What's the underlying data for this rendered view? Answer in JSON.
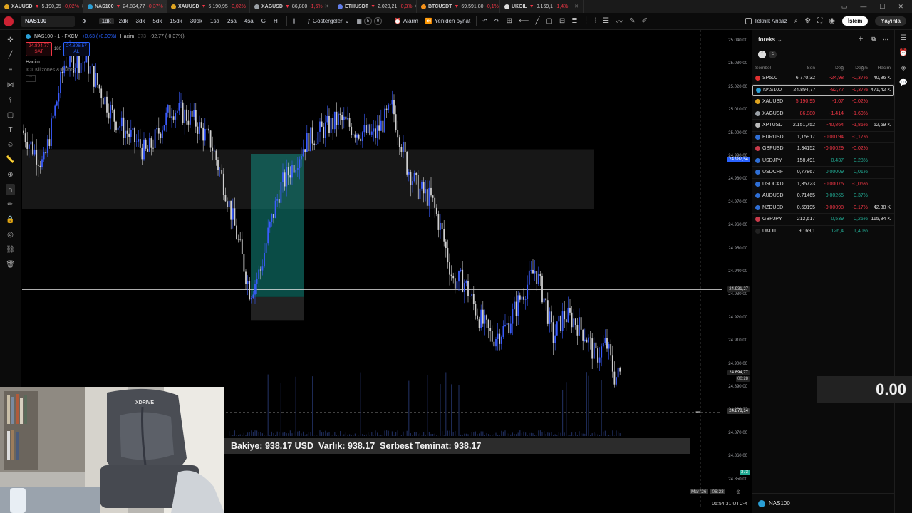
{
  "tabs": [
    {
      "symbol": "XAUUSD",
      "text": "5.190,95",
      "chg": "-0,02%",
      "color": "#e0a520"
    },
    {
      "symbol": "NAS100",
      "text": "24.894,77",
      "chg": "-0,37%",
      "color": "#2a9fd6"
    },
    {
      "symbol": "XAUUSD",
      "text": "5.190,95",
      "chg": "-0,02%",
      "color": "#e0a520"
    },
    {
      "symbol": "XAGUSD",
      "text": "86,880",
      "chg": "-1,6%",
      "color": "#9aa0a6"
    },
    {
      "symbol": "ETHUSDT",
      "text": "2.020,21",
      "chg": "-0,3%",
      "color": "#627eea"
    },
    {
      "symbol": "BTCUSDT",
      "text": "69.591,80",
      "chg": "-0,1%",
      "color": "#f7931a"
    },
    {
      "symbol": "UKOIL",
      "text": "9.169,1",
      "chg": "-1,4%",
      "color": "#ddd"
    }
  ],
  "toolbar": {
    "symbol": "NAS100",
    "timeframes": [
      "1dk",
      "2dk",
      "3dk",
      "5dk",
      "15dk",
      "30dk",
      "1sa",
      "2sa",
      "4sa",
      "G",
      "H"
    ],
    "active_tf": "1dk",
    "indicators": "Göstergeler",
    "count1": "5",
    "count2": "0",
    "alarm": "Alarm",
    "replay": "Yeniden oynat",
    "tech": "Teknik Analiz",
    "trade": "İşlem",
    "publish": "Yayınla"
  },
  "legend": {
    "title": "NAS100 · 1 · FXCM",
    "chg": "+0,63 (+0,00%)",
    "volume_label": "Hacim",
    "volume_val": "373",
    "volume_chg": "-92,77 (-0,37%)",
    "sell_price": "24.894,77",
    "sell_label": "SAT",
    "spread": "180",
    "buy_price": "24.896,57",
    "buy_label": "AL",
    "hacim": "Hacim",
    "indicator": "ICT Killzones & Pivots"
  },
  "price_axis": {
    "ticks": [
      "25.040,00",
      "25.030,00",
      "25.020,00",
      "25.010,00",
      "25.000,00",
      "24.990,00",
      "24.980,00",
      "24.970,00",
      "24.960,00",
      "24.950,00",
      "24.940,00",
      "24.930,00",
      "24.920,00",
      "24.910,00",
      "24.900,00",
      "24.890,00",
      "24.880,00",
      "24.870,00",
      "24.860,00",
      "24.850,00"
    ],
    "label_top": "24.987,54",
    "label_line": "24.931,27",
    "label_last": "24.894,77",
    "label_countdown": "00:28",
    "label_cross": "24.878,14",
    "vol_badge": "373"
  },
  "watchlist": {
    "name": "foreks",
    "headers": [
      "Sembol",
      "Son",
      "Değ",
      "Değ%",
      "Hacim"
    ],
    "rows": [
      {
        "sym": "SP500",
        "last": "6.770,32",
        "chg": "-24,98",
        "pct": "-0,37%",
        "vol": "40,86 K",
        "dir": "neg",
        "color": "#e03030"
      },
      {
        "sym": "NAS100",
        "last": "24.894,77",
        "chg": "-92,77",
        "pct": "-0,37%",
        "vol": "471,42 K",
        "dir": "neg",
        "color": "#2a9fd6"
      },
      {
        "sym": "XAUUSD",
        "last": "5.190,95",
        "chg": "-1,07",
        "pct": "-0,02%",
        "vol": "",
        "dir": "neg",
        "color": "#e0a520"
      },
      {
        "sym": "XAGUSD",
        "last": "86,880",
        "chg": "-1,414",
        "pct": "-1,60%",
        "vol": "",
        "dir": "neg",
        "color": "#9aa0a6"
      },
      {
        "sym": "XPTUSD",
        "last": "2.151,752",
        "chg": "-40,864",
        "pct": "-1,86%",
        "vol": "52,69 K",
        "dir": "neg",
        "color": "#bbb"
      },
      {
        "sym": "EURUSD",
        "last": "1,15917",
        "chg": "-0,00194",
        "pct": "-0,17%",
        "vol": "",
        "dir": "neg",
        "color": "#2f6fd6"
      },
      {
        "sym": "GBPUSD",
        "last": "1,34152",
        "chg": "-0,00029",
        "pct": "-0,02%",
        "vol": "",
        "dir": "neg",
        "color": "#c83a4a"
      },
      {
        "sym": "USDJPY",
        "last": "158,491",
        "chg": "0,437",
        "pct": "0,28%",
        "vol": "",
        "dir": "pos",
        "color": "#2f6fd6"
      },
      {
        "sym": "USDCHF",
        "last": "0,77867",
        "chg": "0,00009",
        "pct": "0,01%",
        "vol": "",
        "dir": "pos",
        "color": "#2f6fd6"
      },
      {
        "sym": "USDCAD",
        "last": "1,35723",
        "chg": "-0,00075",
        "pct": "-0,06%",
        "vol": "",
        "dir": "neg",
        "color": "#2f6fd6"
      },
      {
        "sym": "AUDUSD",
        "last": "0,71465",
        "chg": "0,00265",
        "pct": "0,37%",
        "vol": "",
        "dir": "pos",
        "color": "#2f6fd6"
      },
      {
        "sym": "NZDUSD",
        "last": "0,59195",
        "chg": "-0,00098",
        "pct": "-0,17%",
        "vol": "42,38 K",
        "dir": "neg",
        "color": "#2f6fd6"
      },
      {
        "sym": "GBPJPY",
        "last": "212,617",
        "chg": "0,539",
        "pct": "0,25%",
        "vol": "115,84 K",
        "dir": "pos",
        "color": "#c83a4a"
      },
      {
        "sym": "UKOIL",
        "last": "9.169,1",
        "chg": "126,4",
        "pct": "1,40%",
        "vol": "",
        "dir": "pos",
        "color": "#222"
      }
    ],
    "footer_symbol": "NAS100"
  },
  "balance_text": "Bakiye: 938.17 USD  Varlık: 938.17  Serbest Teminat: 938.17",
  "pnl": "0.00",
  "time_axis": {
    "date": "Mar '26",
    "time": "06:23",
    "clock": "05:54:31 UTC-4"
  },
  "webcam": {
    "chair_brand": "XDRIVE"
  }
}
